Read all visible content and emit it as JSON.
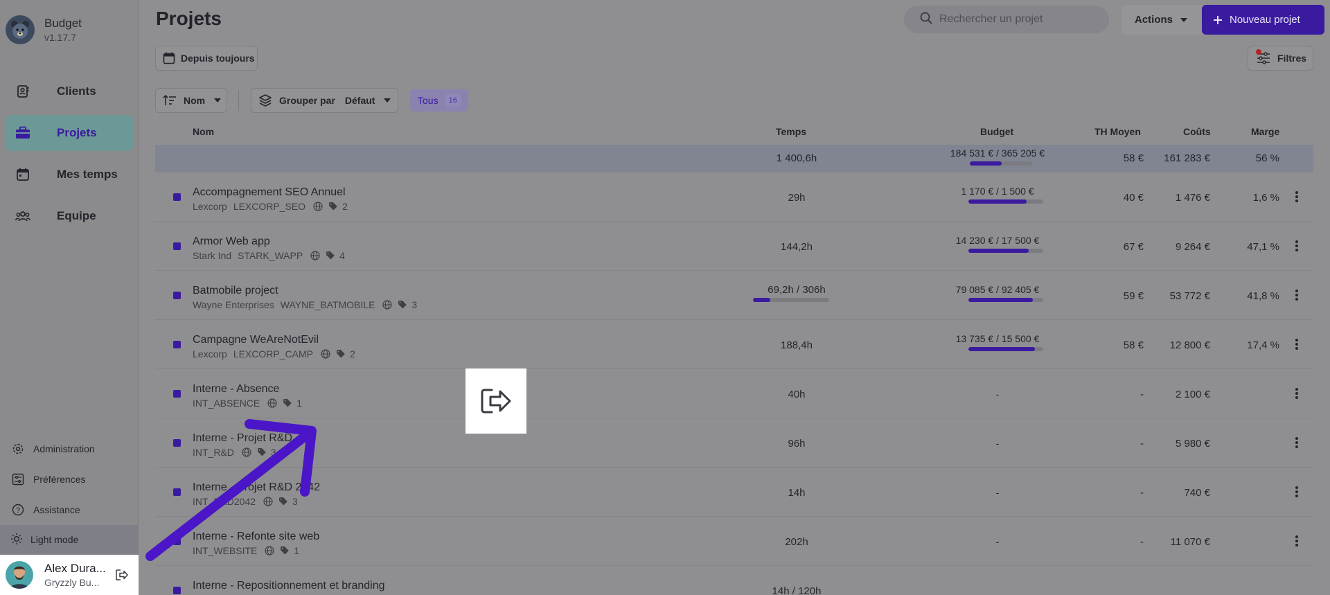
{
  "app": {
    "name": "Budget",
    "version": "v1.17.7"
  },
  "nav": [
    {
      "label": "Clients",
      "icon": "contacts-icon",
      "active": false
    },
    {
      "label": "Projets",
      "icon": "briefcase-icon",
      "active": true
    },
    {
      "label": "Mes temps",
      "icon": "calendar-icon",
      "active": false
    },
    {
      "label": "Equipe",
      "icon": "team-icon",
      "active": false
    }
  ],
  "bottom_nav": [
    {
      "label": "Administration",
      "icon": "gear-icon"
    },
    {
      "label": "Préférences",
      "icon": "settings-sliders-icon"
    },
    {
      "label": "Assistance",
      "icon": "help-icon"
    }
  ],
  "light_mode": {
    "label": "Light mode",
    "icon": "sun-icon"
  },
  "user": {
    "name": "Alex Dura...",
    "org": "Gryzzly Bu..."
  },
  "header": {
    "title": "Projets",
    "search_placeholder": "Rechercher un projet",
    "actions_label": "Actions",
    "new_label": "Nouveau projet"
  },
  "toolbar": {
    "period_label": "Depuis toujours",
    "filters_label": "Filtres",
    "sort_label": "Nom",
    "group_label": "Grouper par",
    "group_value": "Défaut",
    "all_label": "Tous",
    "all_count": "16"
  },
  "columns": {
    "name": "Nom",
    "temps": "Temps",
    "budget": "Budget",
    "th": "TH Moyen",
    "couts": "Coûts",
    "marge": "Marge"
  },
  "total": {
    "temps": "1 400,6h",
    "budget": "184 531 € / 365 205 €",
    "budget_progress": 0.51,
    "th": "58 €",
    "couts": "161 283 €",
    "marge": "56 %"
  },
  "rows": [
    {
      "name": "Accompagnement SEO Annuel",
      "client": "Lexcorp",
      "code": "LEXCORP_SEO",
      "tags": "2",
      "temps": "29h",
      "temps_progress": null,
      "budget": "1 170 € / 1 500 €",
      "budget_progress": 0.78,
      "th": "40 €",
      "couts": "1 476 €",
      "marge": "1,6 %"
    },
    {
      "name": "Armor Web app",
      "client": "Stark Ind",
      "code": "STARK_WAPP",
      "tags": "4",
      "temps": "144,2h",
      "temps_progress": null,
      "budget": "14 230 € / 17 500 €",
      "budget_progress": 0.81,
      "th": "67 €",
      "couts": "9 264 €",
      "marge": "47,1 %"
    },
    {
      "name": "Batmobile project",
      "client": "Wayne Enterprises",
      "code": "WAYNE_BATMOBILE",
      "tags": "3",
      "temps": "69,2h / 306h",
      "temps_progress": 0.23,
      "budget": "79 085 € / 92 405 €",
      "budget_progress": 0.86,
      "th": "59 €",
      "couts": "53 772 €",
      "marge": "41,8 %"
    },
    {
      "name": "Campagne WeAreNotEvil",
      "client": "Lexcorp",
      "code": "LEXCORP_CAMP",
      "tags": "2",
      "temps": "188,4h",
      "temps_progress": null,
      "budget": "13 735 € / 15 500 €",
      "budget_progress": 0.89,
      "th": "58 €",
      "couts": "12 800 €",
      "marge": "17,4 %"
    },
    {
      "name": "Interne - Absence",
      "client": "",
      "code": "INT_ABSENCE",
      "tags": "1",
      "temps": "40h",
      "temps_progress": null,
      "budget": "-",
      "budget_progress": null,
      "th": "-",
      "couts": "2 100 €",
      "marge": ""
    },
    {
      "name": "Interne - Projet R&D",
      "client": "",
      "code": "INT_R&D",
      "tags": "3",
      "temps": "96h",
      "temps_progress": null,
      "budget": "-",
      "budget_progress": null,
      "th": "-",
      "couts": "5 980 €",
      "marge": ""
    },
    {
      "name": "Interne - Projet R&D 2042",
      "client": "",
      "code": "INT_R&D2042",
      "tags": "3",
      "temps": "14h",
      "temps_progress": null,
      "budget": "-",
      "budget_progress": null,
      "th": "-",
      "couts": "740 €",
      "marge": ""
    },
    {
      "name": "Interne - Refonte site web",
      "client": "",
      "code": "INT_WEBSITE",
      "tags": "1",
      "temps": "202h",
      "temps_progress": null,
      "budget": "-",
      "budget_progress": null,
      "th": "-",
      "couts": "11 070 €",
      "marge": ""
    },
    {
      "name": "Interne - Repositionnement et branding",
      "client": "",
      "code": "",
      "tags": "",
      "temps": "14h / 120h",
      "temps_progress": null,
      "budget": "",
      "budget_progress": null,
      "th": "",
      "couts": "",
      "marge": ""
    }
  ],
  "callout_icon": "logout-icon",
  "colors": {
    "accent": "#3a1ba0",
    "arrow": "#4a16c8"
  }
}
